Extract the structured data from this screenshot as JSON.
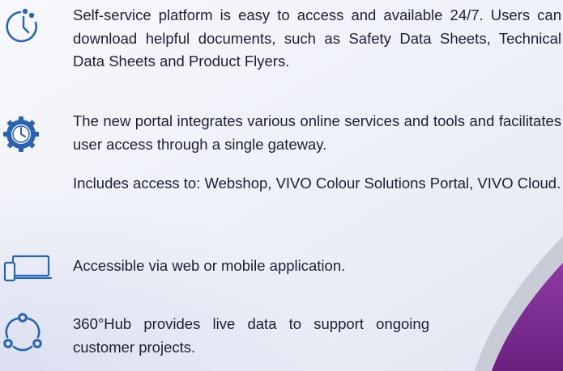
{
  "features": [
    {
      "icon": "clock-icon",
      "paragraphs": [
        "Self-service platform is easy to access and available 24/7. Users can download helpful documents, such as Safety Data Sheets, Technical Data Sheets and Product Flyers."
      ]
    },
    {
      "icon": "gear-stopwatch-icon",
      "paragraphs": [
        "The new portal integrates various online services and tools and facilitates user access through a single gateway.",
        "Includes access to:  Webshop, VIVO Colour Solutions Portal, VIVO Cloud."
      ]
    },
    {
      "icon": "devices-icon",
      "paragraphs": [
        "Accessible via web or mobile application."
      ]
    },
    {
      "icon": "hub-cycle-icon",
      "paragraphs": [
        "360°Hub provides live data to support ongoing customer projects."
      ]
    }
  ],
  "colors": {
    "icon_blue": "#2b64ad",
    "accent_purple": "#7b2a8f",
    "accent_grey": "#c9ccd6"
  }
}
